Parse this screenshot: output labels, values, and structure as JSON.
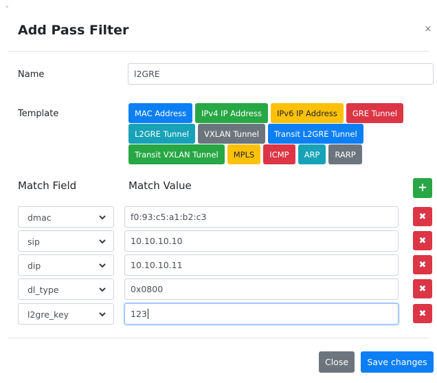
{
  "dialog": {
    "title": "Add Pass Filter",
    "close_glyph": "×",
    "corner_mark": "°"
  },
  "name_field": {
    "label": "Name",
    "value": "l2GRE"
  },
  "template": {
    "label": "Template",
    "rows": [
      [
        {
          "label": "MAC Address",
          "color": "primary"
        },
        {
          "label": "IPv4 IP Address",
          "color": "success"
        },
        {
          "label": "IPv6 IP Address",
          "color": "warning"
        },
        {
          "label": "GRE Tunnel",
          "color": "danger"
        }
      ],
      [
        {
          "label": "L2GRE Tunnel",
          "color": "info"
        },
        {
          "label": "VXLAN Tunnel",
          "color": "secondary"
        },
        {
          "label": "Transit L2GRE Tunnel",
          "color": "primary"
        }
      ],
      [
        {
          "label": "Transit VXLAN Tunnel",
          "color": "success"
        },
        {
          "label": "MPLS",
          "color": "warning"
        },
        {
          "label": "ICMP",
          "color": "danger"
        },
        {
          "label": "ARP",
          "color": "info"
        },
        {
          "label": "RARP",
          "color": "secondary"
        }
      ]
    ]
  },
  "match_table": {
    "field_header": "Match Field",
    "value_header": "Match Value",
    "add_icon": "plus-icon",
    "rows": [
      {
        "field": "dmac",
        "value": "f0:93:c5:a1:b2:c3",
        "active": false
      },
      {
        "field": "sip",
        "value": "10.10.10.10",
        "active": false
      },
      {
        "field": "dip",
        "value": "10.10.10.11",
        "active": false
      },
      {
        "field": "dl_type",
        "value": "0x0800",
        "active": false
      },
      {
        "field": "l2gre_key",
        "value": "123",
        "active": true
      }
    ]
  },
  "footer": {
    "close_label": "Close",
    "save_label": "Save changes"
  },
  "colors": {
    "primary": "#0d7ff5",
    "success": "#28a745",
    "warning": "#ffc107",
    "danger": "#dc3545",
    "info": "#17a2b8",
    "secondary": "#6c757d"
  }
}
